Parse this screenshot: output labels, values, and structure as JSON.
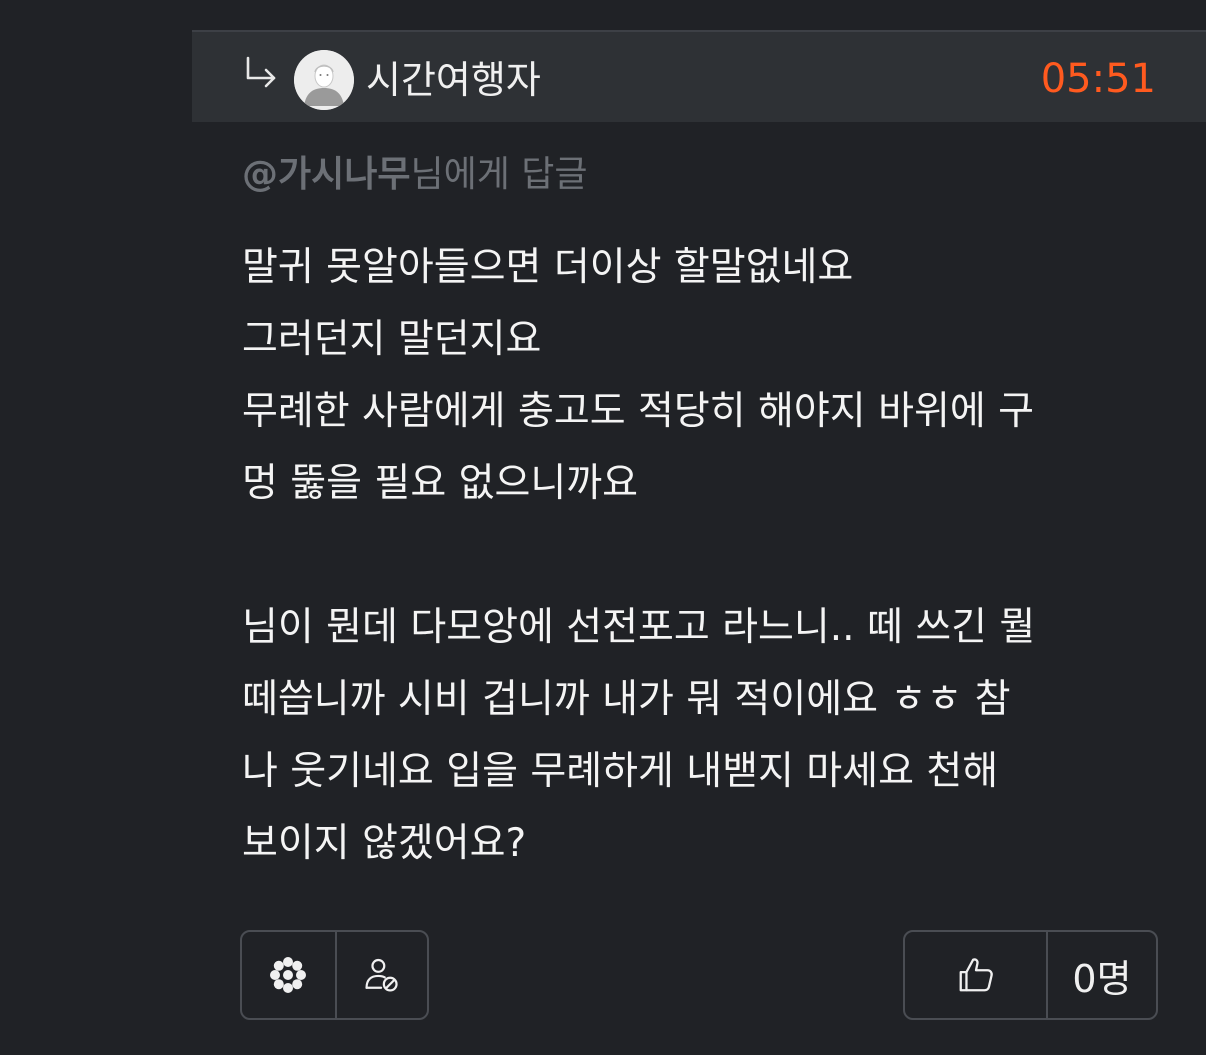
{
  "reply": {
    "arrow_icon": "reply-arrow-icon",
    "avatar_icon": "default-avatar-icon",
    "username": "시간여행자",
    "time": "05:51",
    "time_color": "#ff5a1f"
  },
  "reply_to": {
    "mention": "@가시나무",
    "suffix": "님에게 답글"
  },
  "body": {
    "lines": [
      "말귀 못알아들으면 더이상 할말없네요",
      "그러던지 말던지요",
      "무례한 사람에게 충고도 적당히 해야지 바위에 구",
      "멍 뚫을 필요 없으니까요",
      "",
      "님이 뭔데 다모앙에 선전포고 라느니.. 떼 쓰긴 뭘",
      "떼씁니까 시비 겁니까 내가 뭐 적이에요 ㅎㅎ 참",
      "나 웃기네요 입을 무례하게 내밷지 마세요 천해",
      "보이지 않겠어요?"
    ]
  },
  "actions": {
    "left": [
      {
        "icon": "flower-icon"
      },
      {
        "icon": "user-block-icon"
      }
    ],
    "like_icon": "thumbs-up-icon",
    "like_count": "0명"
  }
}
